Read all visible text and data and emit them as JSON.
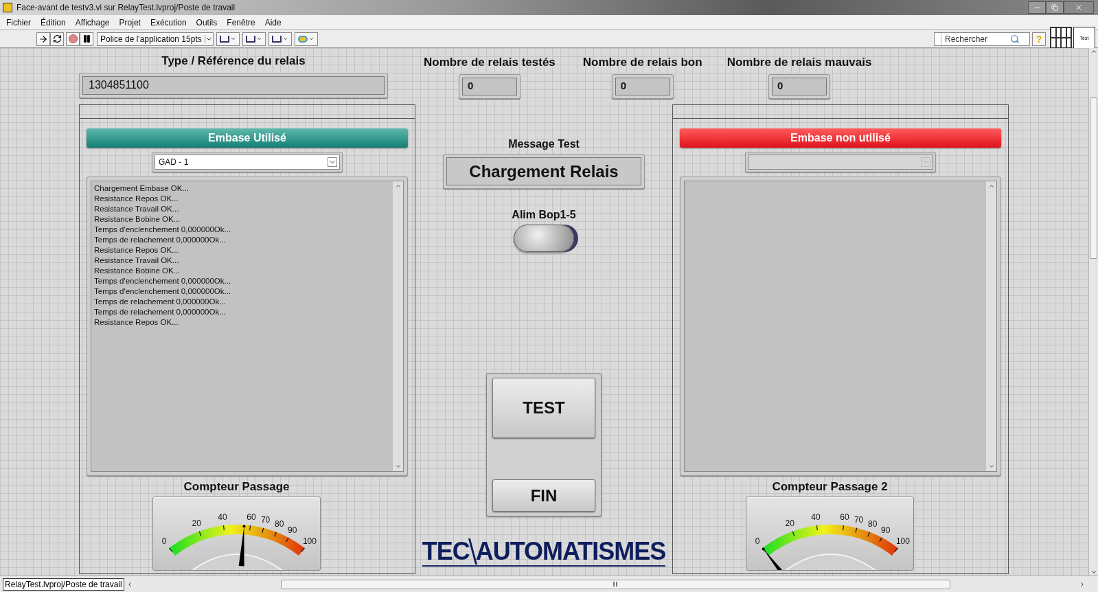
{
  "window": {
    "title": "Face-avant de testv3.vi sur RelayTest.lvproj/Poste de travail"
  },
  "menu": [
    "Fichier",
    "Édition",
    "Affichage",
    "Projet",
    "Exécution",
    "Outils",
    "Fenêtre",
    "Aide"
  ],
  "toolbar": {
    "font": "Police de l'application 15pts",
    "search": {
      "placeholder": "Rechercher"
    },
    "vi_icon_text": "Test",
    "help": "?"
  },
  "reference": {
    "label": "Type / Référence du relais",
    "value": "1304851100"
  },
  "counters": [
    {
      "label": "Nombre de relais testés",
      "value": "0"
    },
    {
      "label": "Nombre de relais bon",
      "value": "0"
    },
    {
      "label": "Nombre de relais mauvais",
      "value": "0"
    }
  ],
  "panels": [
    {
      "header": "Embase Utilisé",
      "in_use": true,
      "select": {
        "value": "GAD - 1",
        "disabled": false
      },
      "log": [
        "Chargement Embase OK...",
        "Resistance Repos OK...",
        "Resistance Travail OK...",
        "Resistance Bobine OK...",
        "Temps d'enclenchement 0,000000Ok...",
        "Temps de relachement 0,000000Ok...",
        "Resistance Repos OK...",
        "Resistance Travail OK...",
        "Resistance Bobine OK...",
        "Temps d'enclenchement 0,000000Ok...",
        "Temps d'enclenchement 0,000000Ok...",
        "Temps de relachement 0,000000Ok...",
        "Temps de relachement 0,000000Ok...",
        "Resistance Repos OK..."
      ],
      "gauge": {
        "label": "Compteur Passage",
        "ticks": [
          "0",
          "20",
          "40",
          "60",
          "70",
          "80",
          "90",
          "100"
        ],
        "level": 0.55
      }
    },
    {
      "header": "Embase non utilisé",
      "in_use": false,
      "select": {
        "disabled": true
      },
      "gauge": {
        "label": "Compteur Passage 2",
        "ticks": [
          "0",
          "20",
          "40",
          "60",
          "70",
          "80",
          "90",
          "100"
        ],
        "level": 0
      }
    }
  ],
  "message": {
    "label": "Message Test",
    "value": "Chargement Relais"
  },
  "led": {
    "label": "Alim Bop1-5",
    "on": false
  },
  "buttons": [
    "TEST",
    "FIN"
  ],
  "logo": {
    "left": "TEC",
    "right": "AUTOMATISMES"
  },
  "status_bar": {
    "path": "RelayTest.lvproj/Poste de travail"
  }
}
